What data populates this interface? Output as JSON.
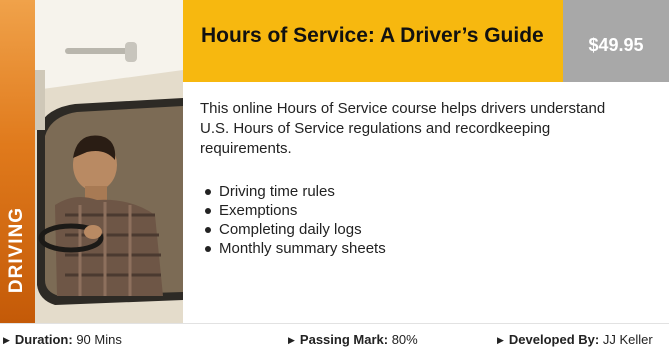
{
  "category": "DRIVING",
  "course": {
    "title": "Hours of Service: A Driver’s Guide",
    "price": "$49.95",
    "description": "This online Hours of Service course helps drivers understand U.S. Hours of Service regulations and recordkeeping requirements.",
    "topics": [
      "Driving time rules",
      "Exemptions",
      "Completing daily logs",
      "Monthly summary sheets"
    ]
  },
  "meta": {
    "duration_label": "Duration:",
    "duration_value": "90 Mins",
    "passing_label": "Passing Mark:",
    "passing_value": "80%",
    "developer_label": "Developed By:",
    "developer_value": "JJ Keller"
  },
  "colors": {
    "title_bar": "#f7b80f",
    "price_box": "#a8a8a8",
    "category_strip": "#e07a1c"
  }
}
